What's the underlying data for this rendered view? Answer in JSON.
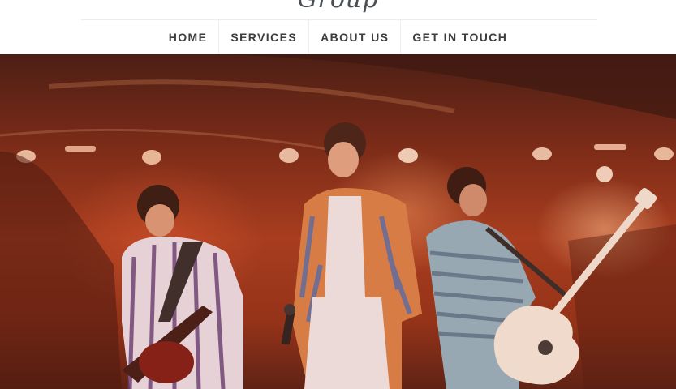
{
  "brand": {
    "logo_text": "Group"
  },
  "nav": {
    "items": [
      {
        "label": "HOME"
      },
      {
        "label": "SERVICES"
      },
      {
        "label": "ABOUT US"
      },
      {
        "label": "GET IN TOUCH"
      }
    ]
  },
  "hero": {
    "image": "band-concert-photo"
  },
  "colors": {
    "nav_text": "#3d3d3d",
    "divider": "#ececec",
    "hero_base": "#a23c1f"
  }
}
